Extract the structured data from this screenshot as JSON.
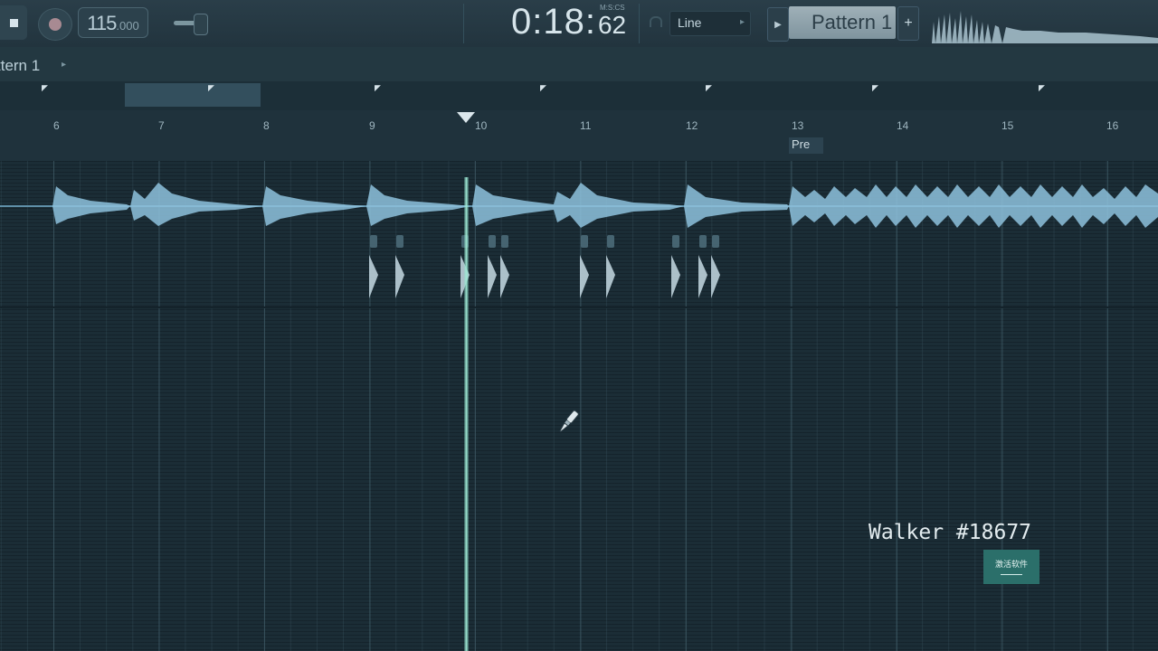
{
  "toolbar": {
    "tempo_main": "115",
    "tempo_decimals": ".000",
    "time_main": "0:18:",
    "time_cs": "62",
    "time_format": "M:S:CS",
    "snap_mode": "Line",
    "pattern_name": "Pattern 1",
    "add_pattern": "+",
    "pattern_arrow": "▶",
    "snap_arrow": "▸"
  },
  "pattern_row": {
    "label": "ttern 1",
    "arrow": "▸"
  },
  "ruler": {
    "bars": [
      "6",
      "7",
      "8",
      "9",
      "10",
      "11",
      "12",
      "13",
      "14",
      "15",
      "16"
    ],
    "marker_label": "Pre"
  },
  "overlay": {
    "watermark": "Walker #18677",
    "badge_text": "激活软件"
  },
  "colors": {
    "background": "#1b2d36",
    "waveform": "#8ec2dd",
    "playhead": "#9fe8d4",
    "badge": "#2b6f6a"
  },
  "icons": {
    "stop": "stop-icon",
    "record": "record-icon",
    "snap": "magnet-icon",
    "cursor": "paint-brush-cursor-icon"
  }
}
